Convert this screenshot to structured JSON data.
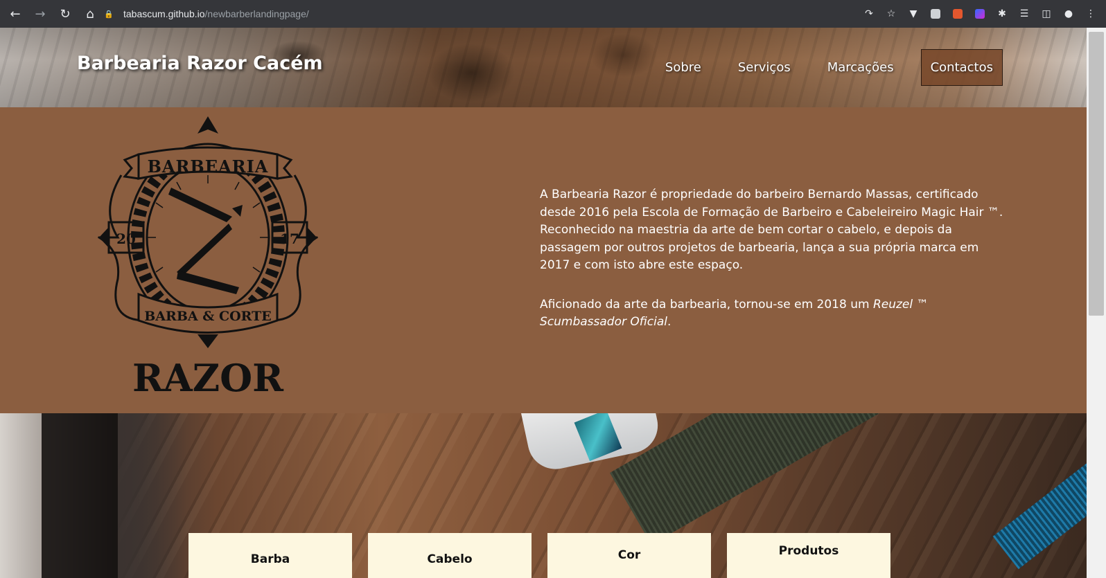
{
  "browser": {
    "url_host": "tabascum.github.io",
    "url_path": "/newbarberlandingpage/",
    "nav_icons": [
      "back-icon",
      "forward-icon",
      "reload-icon",
      "home-icon"
    ],
    "toolbar_icons": [
      "share-icon",
      "bookmark-star-icon",
      "extension-icon",
      "extension-icon",
      "extension-icon",
      "extension-icon",
      "extensions-puzzle-icon",
      "media-controls-icon",
      "side-panel-icon",
      "profile-icon",
      "menu-kebab-icon"
    ]
  },
  "header": {
    "brand": "Barbearia Razor Cacém",
    "nav": [
      {
        "label": "Sobre"
      },
      {
        "label": "Serviços"
      },
      {
        "label": "Marcações"
      },
      {
        "label": "Contactos"
      }
    ],
    "active_color": "#7a4a2c"
  },
  "about": {
    "logo": {
      "top_text": "BARBEARIA",
      "year_left": "20",
      "year_right": "17",
      "ribbon_text": "BARBA & CORTE",
      "wordmark": "RAZOR"
    },
    "paragraph1": "A Barbearia Razor é propriedade do barbeiro Bernardo Massas, certificado desde 2016 pela Escola de Formação de Barbeiro e Cabeleireiro Magic Hair ™. Reconhecido na maestria da arte de bem cortar o cabelo, e depois da passagem por outros projetos de barbearia, lança a sua própria marca em 2017 e com isto abre este espaço.",
    "paragraph2_lead": "Aficionado da arte da barbearia, tornou-se em 2018 um ",
    "paragraph2_em": "Reuzel ™ Scumbassador Oficial",
    "paragraph2_end": ".",
    "background_color": "#8b5e40"
  },
  "services": {
    "cards": [
      {
        "label": "Barba"
      },
      {
        "label": "Cabelo"
      },
      {
        "label": "Cor"
      },
      {
        "label": "Produtos"
      }
    ]
  }
}
